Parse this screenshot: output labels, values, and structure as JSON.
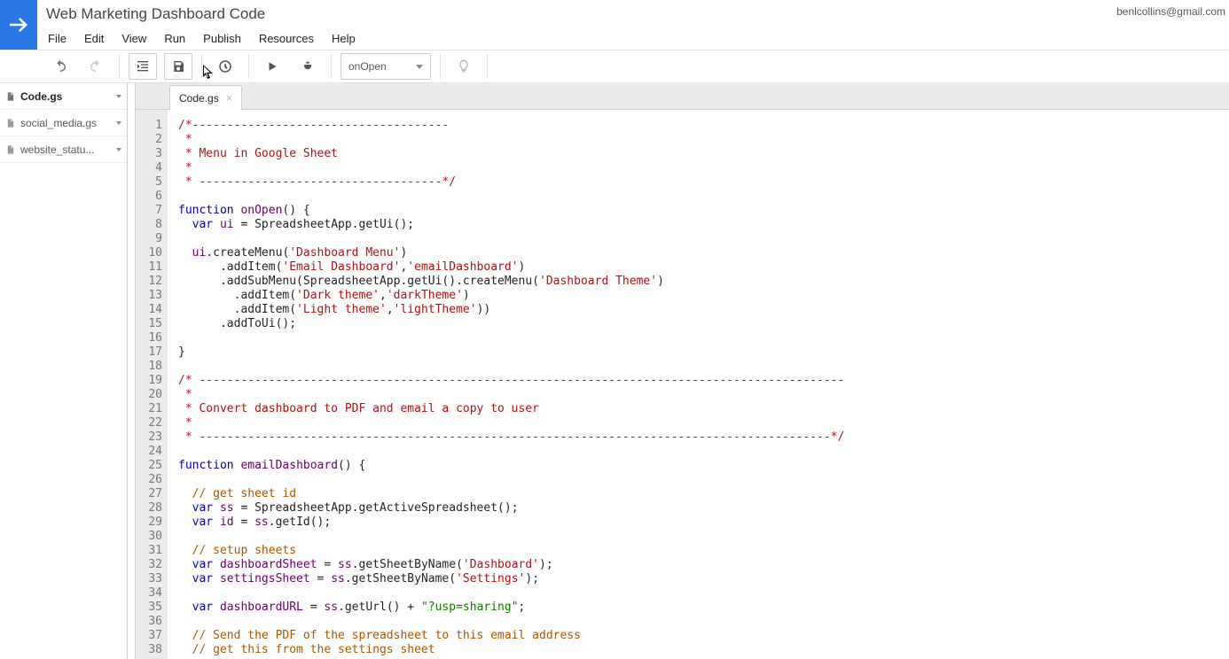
{
  "user_email": "benlcollins@gmail.com",
  "project_title": "Web Marketing Dashboard Code",
  "menu": [
    "File",
    "Edit",
    "View",
    "Run",
    "Publish",
    "Resources",
    "Help"
  ],
  "selected_function": "onOpen",
  "sidebar_files": [
    {
      "name": "Code.gs",
      "active": true
    },
    {
      "name": "social_media.gs",
      "active": false
    },
    {
      "name": "website_statu...",
      "active": false
    }
  ],
  "active_tab": "Code.gs",
  "code_lines": [
    {
      "n": 1,
      "segs": [
        {
          "t": "/*-------------------------------------",
          "c": "red"
        }
      ]
    },
    {
      "n": 2,
      "segs": [
        {
          "t": " *",
          "c": "red"
        }
      ]
    },
    {
      "n": 3,
      "segs": [
        {
          "t": " * Menu in Google Sheet",
          "c": "red"
        }
      ]
    },
    {
      "n": 4,
      "segs": [
        {
          "t": " *",
          "c": "red"
        }
      ]
    },
    {
      "n": 5,
      "segs": [
        {
          "t": " * -----------------------------------*/",
          "c": "red"
        }
      ]
    },
    {
      "n": 6,
      "segs": []
    },
    {
      "n": 7,
      "segs": [
        {
          "t": "function",
          "c": "blue"
        },
        {
          "t": " "
        },
        {
          "t": "onOpen",
          "c": "purple"
        },
        {
          "t": "() {"
        }
      ]
    },
    {
      "n": 8,
      "segs": [
        {
          "t": "  "
        },
        {
          "t": "var",
          "c": "blue"
        },
        {
          "t": " "
        },
        {
          "t": "ui",
          "c": "purple"
        },
        {
          "t": " = SpreadsheetApp.getUi();"
        }
      ]
    },
    {
      "n": 9,
      "segs": []
    },
    {
      "n": 10,
      "segs": [
        {
          "t": "  "
        },
        {
          "t": "ui",
          "c": "purple"
        },
        {
          "t": ".createMenu("
        },
        {
          "t": "'Dashboard Menu'",
          "c": "red"
        },
        {
          "t": ")"
        }
      ]
    },
    {
      "n": 11,
      "segs": [
        {
          "t": "      .addItem("
        },
        {
          "t": "'Email Dashboard'",
          "c": "red"
        },
        {
          "t": ","
        },
        {
          "t": "'emailDashboard'",
          "c": "red"
        },
        {
          "t": ")"
        }
      ]
    },
    {
      "n": 12,
      "segs": [
        {
          "t": "      .addSubMenu(SpreadsheetApp.getUi().createMenu("
        },
        {
          "t": "'Dashboard Theme'",
          "c": "red"
        },
        {
          "t": ")"
        }
      ]
    },
    {
      "n": 13,
      "segs": [
        {
          "t": "        .addItem("
        },
        {
          "t": "'Dark theme'",
          "c": "red"
        },
        {
          "t": ","
        },
        {
          "t": "'darkTheme'",
          "c": "red"
        },
        {
          "t": ")"
        }
      ]
    },
    {
      "n": 14,
      "segs": [
        {
          "t": "        .addItem("
        },
        {
          "t": "'Light theme'",
          "c": "red"
        },
        {
          "t": ","
        },
        {
          "t": "'lightTheme'",
          "c": "red"
        },
        {
          "t": "))"
        }
      ]
    },
    {
      "n": 15,
      "segs": [
        {
          "t": "      .addToUi();"
        }
      ]
    },
    {
      "n": 16,
      "segs": []
    },
    {
      "n": 17,
      "segs": [
        {
          "t": "}"
        }
      ]
    },
    {
      "n": 18,
      "segs": []
    },
    {
      "n": 19,
      "segs": [
        {
          "t": "/* ---------------------------------------------------------------------------------------------",
          "c": "red"
        }
      ]
    },
    {
      "n": 20,
      "segs": [
        {
          "t": " *",
          "c": "red"
        }
      ]
    },
    {
      "n": 21,
      "segs": [
        {
          "t": " * Convert dashboard to PDF and email a copy to user",
          "c": "red"
        }
      ]
    },
    {
      "n": 22,
      "segs": [
        {
          "t": " *",
          "c": "red"
        }
      ]
    },
    {
      "n": 23,
      "segs": [
        {
          "t": " * -------------------------------------------------------------------------------------------*/",
          "c": "red"
        }
      ]
    },
    {
      "n": 24,
      "segs": []
    },
    {
      "n": 25,
      "segs": [
        {
          "t": "function",
          "c": "blue"
        },
        {
          "t": " "
        },
        {
          "t": "emailDashboard",
          "c": "purple"
        },
        {
          "t": "() {"
        }
      ]
    },
    {
      "n": 26,
      "segs": []
    },
    {
      "n": 27,
      "segs": [
        {
          "t": "  "
        },
        {
          "t": "// get sheet id",
          "c": "orange"
        }
      ]
    },
    {
      "n": 28,
      "segs": [
        {
          "t": "  "
        },
        {
          "t": "var",
          "c": "blue"
        },
        {
          "t": " "
        },
        {
          "t": "ss",
          "c": "purple"
        },
        {
          "t": " = SpreadsheetApp.getActiveSpreadsheet();"
        }
      ]
    },
    {
      "n": 29,
      "segs": [
        {
          "t": "  "
        },
        {
          "t": "var",
          "c": "blue"
        },
        {
          "t": " "
        },
        {
          "t": "id",
          "c": "purple"
        },
        {
          "t": " = "
        },
        {
          "t": "ss",
          "c": "purple"
        },
        {
          "t": ".getId();"
        }
      ]
    },
    {
      "n": 30,
      "segs": []
    },
    {
      "n": 31,
      "segs": [
        {
          "t": "  "
        },
        {
          "t": "// setup sheets",
          "c": "orange"
        }
      ]
    },
    {
      "n": 32,
      "segs": [
        {
          "t": "  "
        },
        {
          "t": "var",
          "c": "blue"
        },
        {
          "t": " "
        },
        {
          "t": "dashboardSheet",
          "c": "purple"
        },
        {
          "t": " = "
        },
        {
          "t": "ss",
          "c": "purple"
        },
        {
          "t": ".getSheetByName("
        },
        {
          "t": "'Dashboard'",
          "c": "red"
        },
        {
          "t": ");"
        }
      ]
    },
    {
      "n": 33,
      "segs": [
        {
          "t": "  "
        },
        {
          "t": "var",
          "c": "blue"
        },
        {
          "t": " "
        },
        {
          "t": "settingsSheet",
          "c": "purple"
        },
        {
          "t": " = "
        },
        {
          "t": "ss",
          "c": "purple"
        },
        {
          "t": ".getSheetByName("
        },
        {
          "t": "'Settings'",
          "c": "red"
        },
        {
          "t": ");"
        }
      ]
    },
    {
      "n": 34,
      "segs": []
    },
    {
      "n": 35,
      "segs": [
        {
          "t": "  "
        },
        {
          "t": "var",
          "c": "blue"
        },
        {
          "t": " "
        },
        {
          "t": "dashboardURL",
          "c": "purple"
        },
        {
          "t": " = "
        },
        {
          "t": "ss",
          "c": "purple"
        },
        {
          "t": ".getUrl() + "
        },
        {
          "t": "\"?usp=sharing\"",
          "c": "green"
        },
        {
          "t": ";"
        }
      ]
    },
    {
      "n": 36,
      "segs": []
    },
    {
      "n": 37,
      "segs": [
        {
          "t": "  "
        },
        {
          "t": "// Send the PDF of the spreadsheet to this email address",
          "c": "orange"
        }
      ]
    },
    {
      "n": 38,
      "segs": [
        {
          "t": "  "
        },
        {
          "t": "// get this from the settings sheet",
          "c": "orange"
        }
      ]
    }
  ]
}
